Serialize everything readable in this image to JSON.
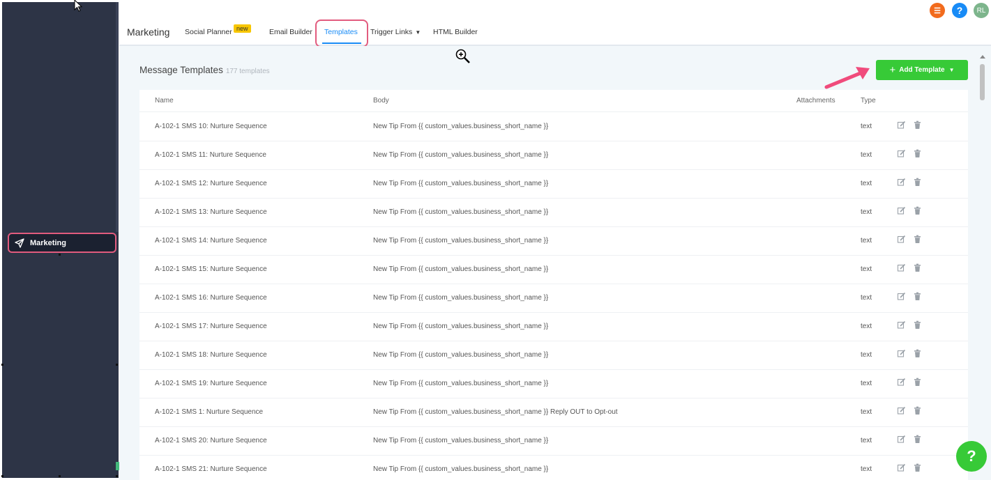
{
  "sidebar": {
    "active_item": {
      "label": "Marketing",
      "icon": "paper-plane-icon"
    }
  },
  "topbar": {
    "title": "Marketing",
    "tabs": [
      {
        "label": "Social Planner",
        "badge": "new"
      },
      {
        "label": "Email Builder"
      },
      {
        "label": "Templates",
        "active": true
      },
      {
        "label": "Trigger Links",
        "dropdown": true
      },
      {
        "label": "HTML Builder"
      }
    ],
    "icons": [
      {
        "name": "list-icon",
        "text": "☰",
        "color": "#f26b1d"
      },
      {
        "name": "help-icon",
        "text": "?",
        "color": "#188bf6"
      },
      {
        "name": "user-avatar",
        "text": "RL",
        "color": "#7db58c"
      }
    ]
  },
  "main": {
    "section_title": "Message Templates",
    "template_count": "177 templates",
    "add_button_label": "Add Template",
    "table": {
      "columns": [
        "Name",
        "Body",
        "Attachments",
        "Type"
      ],
      "rows": [
        {
          "name": "A-102-1 SMS 10: Nurture Sequence",
          "body": "New Tip From {{ custom_values.business_short_name }}",
          "type": "text"
        },
        {
          "name": "A-102-1 SMS 11: Nurture Sequence",
          "body": "New Tip From {{ custom_values.business_short_name }}",
          "type": "text"
        },
        {
          "name": "A-102-1 SMS 12: Nurture Sequence",
          "body": "New Tip From {{ custom_values.business_short_name }}",
          "type": "text"
        },
        {
          "name": "A-102-1 SMS 13: Nurture Sequence",
          "body": "New Tip From {{ custom_values.business_short_name }}",
          "type": "text"
        },
        {
          "name": "A-102-1 SMS 14: Nurture Sequence",
          "body": "New Tip From {{ custom_values.business_short_name }}",
          "type": "text"
        },
        {
          "name": "A-102-1 SMS 15: Nurture Sequence",
          "body": "New Tip From {{ custom_values.business_short_name }}",
          "type": "text"
        },
        {
          "name": "A-102-1 SMS 16: Nurture Sequence",
          "body": "New Tip From {{ custom_values.business_short_name }}",
          "type": "text"
        },
        {
          "name": "A-102-1 SMS 17: Nurture Sequence",
          "body": "New Tip From {{ custom_values.business_short_name }}",
          "type": "text"
        },
        {
          "name": "A-102-1 SMS 18: Nurture Sequence",
          "body": "New Tip From {{ custom_values.business_short_name }}",
          "type": "text"
        },
        {
          "name": "A-102-1 SMS 19: Nurture Sequence",
          "body": "New Tip From {{ custom_values.business_short_name }}",
          "type": "text"
        },
        {
          "name": "A-102-1 SMS 1: Nurture Sequence",
          "body": "New Tip From {{ custom_values.business_short_name }} Reply OUT to Opt-out",
          "type": "text"
        },
        {
          "name": "A-102-1 SMS 20: Nurture Sequence",
          "body": "New Tip From {{ custom_values.business_short_name }}",
          "type": "text"
        },
        {
          "name": "A-102-1 SMS 21: Nurture Sequence",
          "body": "New Tip From {{ custom_values.business_short_name }}",
          "type": "text"
        }
      ]
    }
  },
  "help_fab": {
    "label": "?"
  },
  "colors": {
    "sidebar": "#2d3446",
    "accent": "#188bf6",
    "add_button": "#37ca37",
    "highlight": "#e25b7e"
  }
}
